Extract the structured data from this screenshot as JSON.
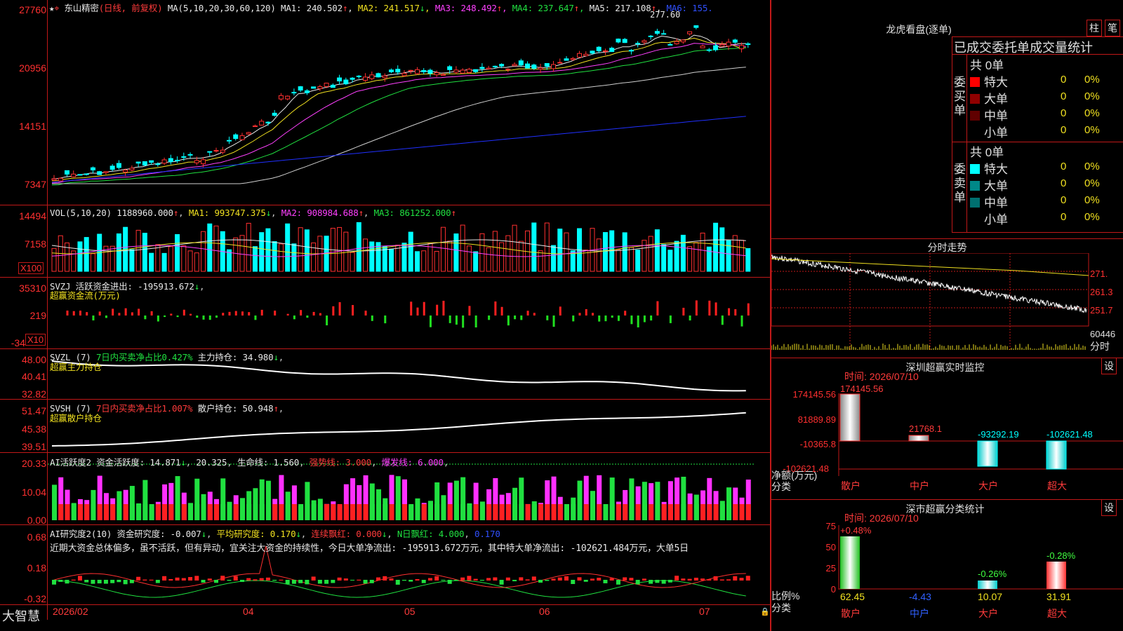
{
  "stock": {
    "name": "东山精密",
    "mode": "(日线, 前复权)"
  },
  "main_chart": {
    "ma_title": "MA(5,10,20,30,60,120)",
    "ma": [
      {
        "label": "MA1: 240.502",
        "arrow": "↑",
        "color": "#e8e8e8"
      },
      {
        "label": "MA2: 241.517",
        "arrow": "↓",
        "color": "#f0e020"
      },
      {
        "label": "MA3: 248.492",
        "arrow": "↑",
        "color": "#ff40ff"
      },
      {
        "label": "MA4: 237.647",
        "arrow": "↑",
        "color": "#20e040"
      },
      {
        "label": "MA5: 217.108",
        "arrow": "↑",
        "color": "#e8e8e8"
      },
      {
        "label": "MA6: 155.",
        "arrow": "",
        "color": "#3050ff"
      }
    ],
    "y_labels": [
      "27760",
      "20956",
      "14151",
      "7347"
    ],
    "peak_label": "277.60",
    "star_marks": "*"
  },
  "vol": {
    "title": "VOL(5,10,20)",
    "value": "1188960.000",
    "ma1": "MA1: 993747.375",
    "ma2": "MA2: 908984.688",
    "ma3": "MA3: 861252.000",
    "y_labels": [
      "14494",
      "7158"
    ],
    "unit": "X100"
  },
  "svzj": {
    "title": "SVZJ",
    "label": "活跃资金进出: -195913.672",
    "subtitle": "超赢资金流(万元)",
    "y_labels": [
      "35310",
      "219",
      "-34"
    ],
    "unit": "X10"
  },
  "svzl": {
    "title": "SVZL (7)",
    "ratio": "7日内买卖净占比0.427%",
    "hold": "主力持仓: 34.980",
    "subtitle": "超赢主力持仓",
    "y_labels": [
      "48.00",
      "40.41",
      "32.82"
    ]
  },
  "svsh": {
    "title": "SVSH (7)",
    "ratio": "7日内买卖净占比1.007%",
    "hold": "散户持仓: 50.948",
    "subtitle": "超赢散户持仓",
    "y_labels": [
      "51.47",
      "45.38",
      "39.51"
    ]
  },
  "ai_active": {
    "title": "AI活跃度2",
    "active": "资金活跃度: 14.871",
    "v2": "20.325",
    "life": "生命线: 1.560",
    "strong": "强势线: 3.000",
    "burst": "爆发线: 6.000",
    "y_labels": [
      "20.33",
      "10.04",
      "0.00"
    ]
  },
  "ai_research": {
    "title": "AI研究度2(10)",
    "research": "资金研究度: -0.007",
    "avg": "平均研究度: 0.170",
    "streak": "连续飘红: 0.000",
    "nday": "N日飘红: 4.000",
    "v": "0.170",
    "comment": "近期大资金总体偏多，虽不活跃，但有异动，宜关注大资金的持续性，今日大单净流出: -195913.672万元，其中特大单净流出: -102621.484万元，大单5日",
    "y_labels": [
      "0.68",
      "0.18",
      "-0.32"
    ]
  },
  "x_axis": {
    "labels": [
      "2026/02",
      "04",
      "05",
      "06",
      "07"
    ],
    "brand": "大智慧"
  },
  "dragon": {
    "title": "龙虎看盘(逐单)",
    "tab_bar": "柱",
    "tab_pen": "笔",
    "header": "已成交委托单成交量统计",
    "buy": {
      "side": "委买单",
      "total": "共 0单",
      "rows": [
        {
          "label": "特大",
          "count": "0",
          "pct": "0%",
          "color": "#ff0000"
        },
        {
          "label": "大单",
          "count": "0",
          "pct": "0%",
          "color": "#900000"
        },
        {
          "label": "中单",
          "count": "0",
          "pct": "0%",
          "color": "#600000"
        },
        {
          "label": "小单",
          "count": "0",
          "pct": "0%",
          "color": "#000000"
        }
      ]
    },
    "sell": {
      "side": "委卖单",
      "total": "共 0单",
      "rows": [
        {
          "label": "特大",
          "count": "0",
          "pct": "0%",
          "color": "#00ffff"
        },
        {
          "label": "大单",
          "count": "0",
          "pct": "0%",
          "color": "#008888"
        },
        {
          "label": "中单",
          "count": "0",
          "pct": "0%",
          "color": "#007070"
        },
        {
          "label": "小单",
          "count": "0",
          "pct": "0%",
          "color": "#000000"
        }
      ]
    }
  },
  "intraday": {
    "title": "分时走势",
    "y_labels": [
      "271.",
      "261.3",
      "251.7",
      "60446"
    ],
    "bottom": "分时"
  },
  "monitor": {
    "title": "深圳超赢实时监控",
    "settings": "设",
    "time": "时间: 2026/07/10",
    "y_labels": [
      "174145.56",
      "81889.89",
      "-10365.8",
      "-102621.48"
    ],
    "ylabel": "净额(万元)",
    "xlabel": "分类",
    "categories": [
      "散户",
      "中户",
      "大户",
      "超大"
    ],
    "values": [
      "174145.56",
      "21768.1",
      "-93292.19",
      "-102621.48"
    ]
  },
  "classify": {
    "title": "深市超赢分类统计",
    "settings": "设",
    "time": "时间: 2026/07/10",
    "y_labels": [
      "75",
      "50",
      "25",
      "0"
    ],
    "ylabel": "比例%",
    "xlabel": "分类",
    "categories": [
      "散户",
      "中户",
      "大户",
      "超大"
    ],
    "change": [
      "+0.48%",
      "",
      "-0.26%",
      "-0.28%"
    ],
    "values": [
      "62.45",
      "-4.43",
      "10.07",
      "31.91"
    ]
  }
}
